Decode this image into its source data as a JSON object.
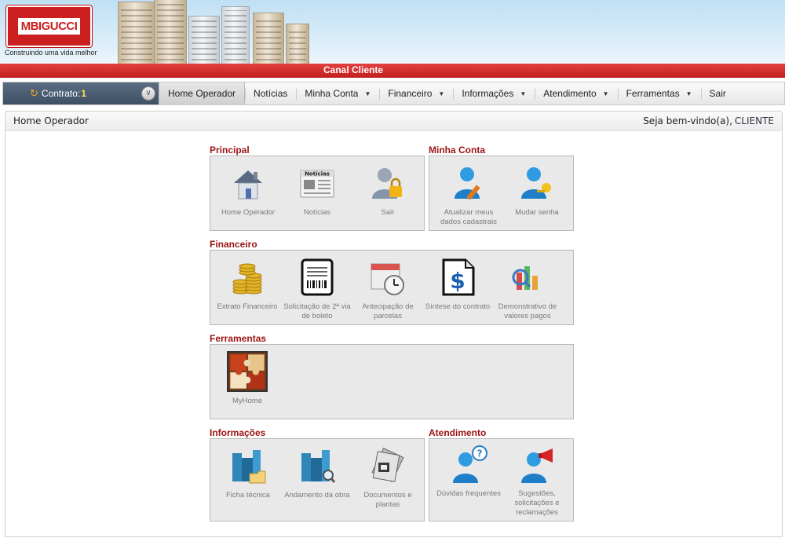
{
  "header": {
    "logo_text": "MBIGUCCI",
    "tagline": "Construindo uma vida melhor",
    "banner_title": "Canal Cliente"
  },
  "contract": {
    "label": "Contrato:",
    "number": "1"
  },
  "nav": [
    {
      "label": "Home Operador",
      "active": true,
      "dropdown": false
    },
    {
      "label": "Notícias",
      "active": false,
      "dropdown": false
    },
    {
      "label": "Minha Conta",
      "active": false,
      "dropdown": true
    },
    {
      "label": "Financeiro",
      "active": false,
      "dropdown": true
    },
    {
      "label": "Informações",
      "active": false,
      "dropdown": true
    },
    {
      "label": "Atendimento",
      "active": false,
      "dropdown": true
    },
    {
      "label": "Ferramentas",
      "active": false,
      "dropdown": true
    },
    {
      "label": "Sair",
      "active": false,
      "dropdown": false
    }
  ],
  "page": {
    "title": "Home Operador",
    "welcome": "Seja bem-vindo(a),",
    "user": "CLIENTE"
  },
  "sections": {
    "principal": {
      "title": "Principal",
      "items": [
        {
          "label": "Home Operador",
          "icon": "house-icon"
        },
        {
          "label": "Notícias",
          "icon": "newspaper-icon",
          "badge": "Notícias"
        },
        {
          "label": "Sair",
          "icon": "user-lock-icon"
        }
      ]
    },
    "minha_conta": {
      "title": "Minha Conta",
      "items": [
        {
          "label": "Atualizar meus dados cadastrais",
          "icon": "user-edit-icon"
        },
        {
          "label": "Mudar senha",
          "icon": "user-key-icon"
        }
      ]
    },
    "financeiro": {
      "title": "Financeiro",
      "items": [
        {
          "label": "Extrato Financeiro",
          "icon": "coins-icon"
        },
        {
          "label": "Solicitação de 2ª via de boleto",
          "icon": "barcode-icon"
        },
        {
          "label": "Antecipação de parcelas",
          "icon": "calendar-clock-icon"
        },
        {
          "label": "Síntese do contrato",
          "icon": "dollar-document-icon"
        },
        {
          "label": "Demonstrativo de valores pagos",
          "icon": "chart-icon"
        }
      ]
    },
    "ferramentas": {
      "title": "Ferramentas",
      "items": [
        {
          "label": "MyHome",
          "icon": "puzzle-icon"
        }
      ]
    },
    "informacoes": {
      "title": "Informações",
      "items": [
        {
          "label": "Ficha técnica",
          "icon": "building-folder-icon"
        },
        {
          "label": "Andamento da obra",
          "icon": "building-search-icon"
        },
        {
          "label": "Documentos e plantas",
          "icon": "documents-icon"
        }
      ]
    },
    "atendimento": {
      "title": "Atendimento",
      "items": [
        {
          "label": "Dúvidas frequentes",
          "icon": "user-question-icon"
        },
        {
          "label": "Sugestões, solicitações e reclamações",
          "icon": "user-megaphone-icon"
        }
      ]
    }
  }
}
